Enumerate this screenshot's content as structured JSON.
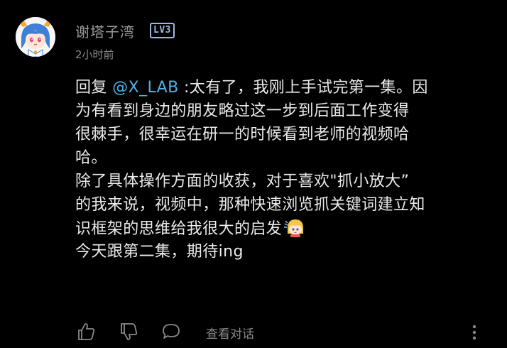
{
  "comment": {
    "username": "谢塔子湾",
    "level_badge": "LV3",
    "timestamp": "2小时前",
    "body": {
      "lines": [
        {
          "prefix": "回复 ",
          "mention": "@X_LAB",
          "text": " :太有了，我刚上手试完第一集。因"
        },
        {
          "text": "为有看到身边的朋友略过这一步到后面工作变得"
        },
        {
          "text": "很棘手，很幸运在研一的时候看到老师的视频哈"
        },
        {
          "text": "哈。"
        },
        {
          "text": "除了具体操作方面的收获，对于喜欢\"抓小放大”"
        },
        {
          "text": "的我来说，视频中，那种快速浏览抓关键词建立知"
        },
        {
          "text": "识框架的思维给我很大的启发"
        },
        {
          "text": "今天跟第二集，期待ing"
        }
      ]
    },
    "inline_emoji": "anime-girl-emoji",
    "actions": {
      "like_icon": "thumbs-up-icon",
      "dislike_icon": "thumbs-down-icon",
      "reply_icon": "comment-bubble-icon",
      "view_replies_label": "查看对话",
      "more_icon": "more-vertical-icon"
    }
  },
  "colors": {
    "background": "#000000",
    "text": "#eaeaea",
    "muted": "#8a8a8a",
    "mention": "#4fb3e8",
    "level_badge": "#9fb7dc"
  }
}
